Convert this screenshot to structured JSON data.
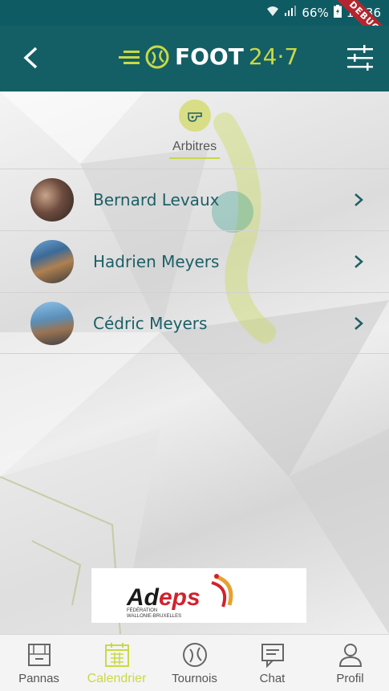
{
  "status_bar": {
    "battery": "66%",
    "time": "11:36",
    "debug_label": "DEBUG"
  },
  "app_bar": {
    "logo_main": "FOOT",
    "logo_accent": "24·7"
  },
  "section": {
    "title": "Arbitres"
  },
  "referees": [
    {
      "name": "Bernard Levaux"
    },
    {
      "name": "Hadrien Meyers"
    },
    {
      "name": "Cédric Meyers"
    }
  ],
  "sponsor": {
    "name_black": "Ad",
    "name_red": "eps",
    "subtitle_line1": "FÉDÉRATION",
    "subtitle_line2": "WALLONIE-BRUXELLES"
  },
  "bottom_nav": [
    {
      "label": "Pannas",
      "active": false
    },
    {
      "label": "Calendrier",
      "active": true
    },
    {
      "label": "Tournois",
      "active": false
    },
    {
      "label": "Chat",
      "active": false
    },
    {
      "label": "Profil",
      "active": false
    }
  ],
  "colors": {
    "primary": "#145f66",
    "accent": "#c9d944",
    "name_text": "#1c5f67"
  }
}
